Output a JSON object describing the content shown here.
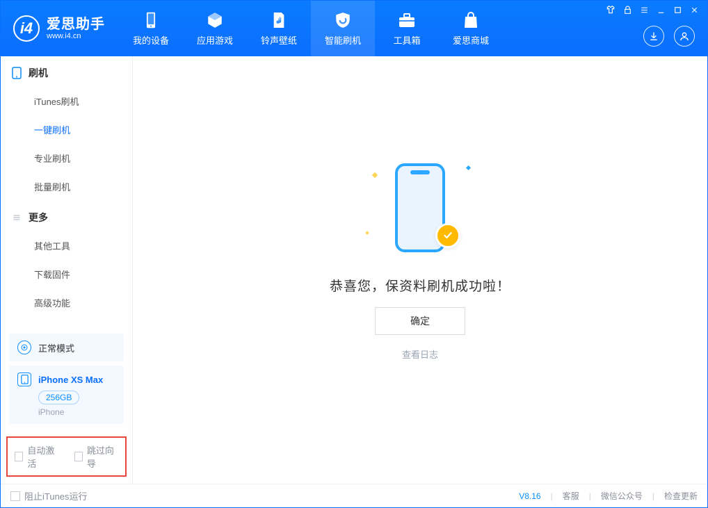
{
  "brand": {
    "cn": "爱思助手",
    "en": "www.i4.cn"
  },
  "nav": {
    "items": [
      {
        "label": "我的设备"
      },
      {
        "label": "应用游戏"
      },
      {
        "label": "铃声壁纸"
      },
      {
        "label": "智能刷机"
      },
      {
        "label": "工具箱"
      },
      {
        "label": "爱思商城"
      }
    ]
  },
  "sidebar": {
    "groups": [
      {
        "title": "刷机",
        "items": [
          "iTunes刷机",
          "一键刷机",
          "专业刷机",
          "批量刷机"
        ]
      },
      {
        "title": "更多",
        "items": [
          "其他工具",
          "下载固件",
          "高级功能"
        ]
      }
    ],
    "active_index": 1,
    "mode_card": "正常模式",
    "device": {
      "name": "iPhone XS Max",
      "storage": "256GB",
      "type": "iPhone"
    },
    "options": {
      "auto_activate": "自动激活",
      "skip_guide": "跳过向导"
    }
  },
  "main": {
    "success_message": "恭喜您，保资料刷机成功啦！",
    "ok_button": "确定",
    "view_log": "查看日志"
  },
  "footer": {
    "block_itunes": "阻止iTunes运行",
    "version": "V8.16",
    "support": "客服",
    "wechat": "微信公众号",
    "check_update": "检查更新"
  }
}
